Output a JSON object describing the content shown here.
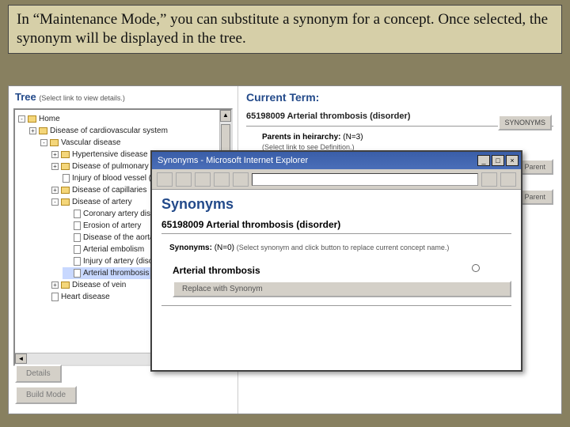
{
  "caption": "In “Maintenance Mode,” you can substitute a synonym for a concept. Once selected, the synonym will be displayed in the tree.",
  "tree": {
    "title": "Tree",
    "subtitle": "(Select link to view details.)",
    "items": [
      {
        "level": 1,
        "expand": "-",
        "icon": "folder",
        "label": "Home"
      },
      {
        "level": 2,
        "expand": "+",
        "icon": "folder",
        "label": "Disease of cardiovascular system"
      },
      {
        "level": 3,
        "expand": "-",
        "icon": "folder",
        "label": "Vascular disease"
      },
      {
        "level": 4,
        "expand": "+",
        "icon": "folder",
        "label": "Hypertensive disease"
      },
      {
        "level": 4,
        "expand": "+",
        "icon": "folder",
        "label": "Disease of pulmonary circulation"
      },
      {
        "level": 4,
        "expand": "",
        "icon": "page",
        "label": "Injury of blood vessel (disorder)"
      },
      {
        "level": 4,
        "expand": "+",
        "icon": "folder",
        "label": "Disease of capillaries"
      },
      {
        "level": 4,
        "expand": "-",
        "icon": "folder",
        "label": "Disease of artery"
      },
      {
        "level": 5,
        "expand": "",
        "icon": "page",
        "label": "Coronary artery disease"
      },
      {
        "level": 5,
        "expand": "",
        "icon": "page",
        "label": "Erosion of artery"
      },
      {
        "level": 5,
        "expand": "",
        "icon": "page",
        "label": "Disease of the aorta"
      },
      {
        "level": 5,
        "expand": "",
        "icon": "page",
        "label": "Arterial embolism"
      },
      {
        "level": 5,
        "expand": "",
        "icon": "page",
        "label": "Injury of artery (disorder)"
      },
      {
        "level": 5,
        "expand": "",
        "icon": "page",
        "label": "Arterial thrombosis",
        "sel": true
      },
      {
        "level": 4,
        "expand": "+",
        "icon": "folder",
        "label": "Disease of vein"
      },
      {
        "level": 3,
        "expand": "",
        "icon": "page",
        "label": "Heart disease"
      }
    ],
    "buttons": {
      "details": "Details",
      "build": "Build Mode"
    }
  },
  "current": {
    "header": "Current Term:",
    "term": "65198009 Arterial thrombosis (disorder)",
    "syn_button": "SYNONYMS",
    "parents_label": "Parents in heirarchy:",
    "parents_count": "(N=3)",
    "parents_hint": "(Select link to see Definition.)",
    "child_button": "Child of this Parent"
  },
  "popup": {
    "title": "Synonyms - Microsoft Internet Explorer",
    "heading": "Synonyms",
    "term": "65198009 Arterial thrombosis (disorder)",
    "syn_label": "Synonyms:",
    "syn_count": "(N=0)",
    "syn_hint": "(Select synonym and click button to replace current concept name.)",
    "entry": "Arterial thrombosis",
    "replace": "Replace with Synonym"
  }
}
